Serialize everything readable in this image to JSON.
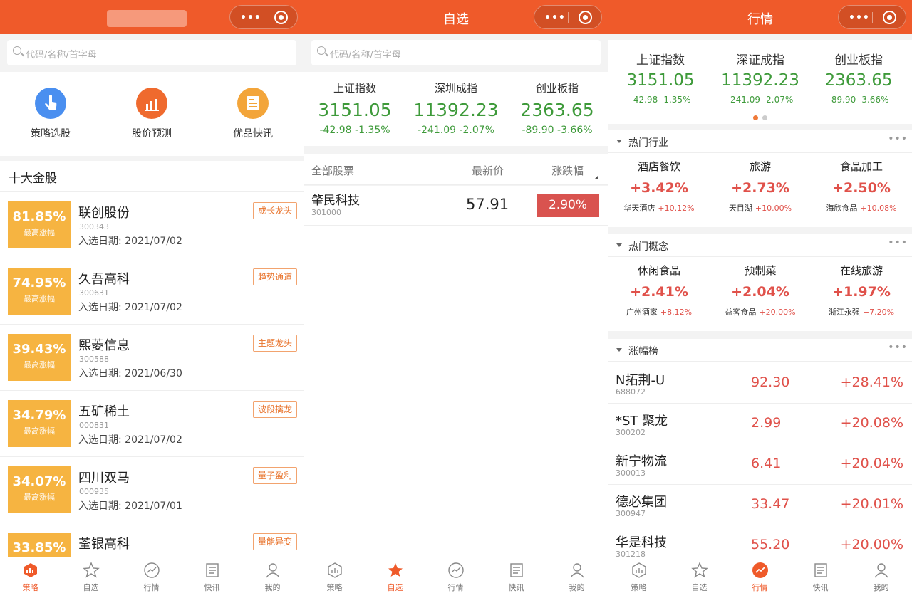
{
  "colors": {
    "accent": "#ef5a2a",
    "up": "#e0514a",
    "down": "#3e9a3a",
    "gold": "#f6b441"
  },
  "panel1": {
    "search_placeholder": "代码/名称/首字母",
    "quick": [
      {
        "label": "策略选股",
        "icon": "pointer-hand-icon",
        "color": "#4a8ff0"
      },
      {
        "label": "股价预测",
        "icon": "bar-chart-icon",
        "color": "#ef6a2e"
      },
      {
        "label": "优品快讯",
        "icon": "news-document-icon",
        "color": "#f3a53a"
      }
    ],
    "section_title": "十大金股",
    "gain_sub": "最高涨幅",
    "stocks": [
      {
        "pct": "81.85%",
        "name": "联创股份",
        "code": "300343",
        "date": "入选日期: 2021/07/02",
        "tag": "成长龙头"
      },
      {
        "pct": "74.95%",
        "name": "久吾高科",
        "code": "300631",
        "date": "入选日期: 2021/07/02",
        "tag": "趋势通道"
      },
      {
        "pct": "39.43%",
        "name": "熙菱信息",
        "code": "300588",
        "date": "入选日期: 2021/06/30",
        "tag": "主题龙头"
      },
      {
        "pct": "34.79%",
        "name": "五矿稀土",
        "code": "000831",
        "date": "入选日期: 2021/07/02",
        "tag": "波段擒龙"
      },
      {
        "pct": "34.07%",
        "name": "四川双马",
        "code": "000935",
        "date": "入选日期: 2021/07/01",
        "tag": "量子盈利"
      },
      {
        "pct": "33.85%",
        "name": "荃银高科",
        "code": "",
        "date": "",
        "tag": "量能异变"
      }
    ]
  },
  "panel2": {
    "title": "自选",
    "search_placeholder": "代码/名称/首字母",
    "indices": [
      {
        "name": "上证指数",
        "value": "3151.05",
        "change": "-42.98  -1.35%"
      },
      {
        "name": "深圳成指",
        "value": "11392.23",
        "change": "-241.09  -2.07%"
      },
      {
        "name": "创业板指",
        "value": "2363.65",
        "change": "-89.90  -3.66%"
      }
    ],
    "headers": {
      "all": "全部股票",
      "price": "最新价",
      "change": "涨跌幅"
    },
    "row": {
      "name": "肇民科技",
      "code": "301000",
      "price": "57.91",
      "change": "2.90%"
    }
  },
  "panel3": {
    "title": "行情",
    "indices": [
      {
        "name": "上证指数",
        "value": "3151.05",
        "change": "-42.98  -1.35%"
      },
      {
        "name": "深证成指",
        "value": "11392.23",
        "change": "-241.09  -2.07%"
      },
      {
        "name": "创业板指",
        "value": "2363.65",
        "change": "-89.90  -3.66%"
      }
    ],
    "hot_industry": {
      "title": "热门行业",
      "more": "•••",
      "items": [
        {
          "name": "酒店餐饮",
          "pct": "+3.42%",
          "lead": "华天酒店",
          "lead_pct": "+10.12%"
        },
        {
          "name": "旅游",
          "pct": "+2.73%",
          "lead": "天目湖",
          "lead_pct": "+10.00%"
        },
        {
          "name": "食品加工",
          "pct": "+2.50%",
          "lead": "海欣食品",
          "lead_pct": "+10.08%"
        }
      ]
    },
    "hot_concept": {
      "title": "热门概念",
      "more": "•••",
      "items": [
        {
          "name": "休闲食品",
          "pct": "+2.41%",
          "lead": "广州酒家",
          "lead_pct": "+8.12%"
        },
        {
          "name": "预制菜",
          "pct": "+2.04%",
          "lead": "益客食品",
          "lead_pct": "+20.00%"
        },
        {
          "name": "在线旅游",
          "pct": "+1.97%",
          "lead": "浙江永强",
          "lead_pct": "+7.20%"
        }
      ]
    },
    "gainers": {
      "title": "涨幅榜",
      "more": "•••",
      "rows": [
        {
          "name": "N拓荆-U",
          "code": "688072",
          "price": "92.30",
          "pct": "+28.41%"
        },
        {
          "name": "*ST 聚龙",
          "code": "300202",
          "price": "2.99",
          "pct": "+20.08%"
        },
        {
          "name": "新宁物流",
          "code": "300013",
          "price": "6.41",
          "pct": "+20.04%"
        },
        {
          "name": "德必集团",
          "code": "300947",
          "price": "33.47",
          "pct": "+20.01%"
        },
        {
          "name": "华是科技",
          "code": "301218",
          "price": "55.20",
          "pct": "+20.00%"
        }
      ]
    }
  },
  "tabs": [
    {
      "label": "策略",
      "icon": "strategy-chart-icon"
    },
    {
      "label": "自选",
      "icon": "star-icon"
    },
    {
      "label": "行情",
      "icon": "trend-line-icon"
    },
    {
      "label": "快讯",
      "icon": "news-list-icon"
    },
    {
      "label": "我的",
      "icon": "user-profile-icon"
    }
  ],
  "capsule": {
    "dots": "•••"
  }
}
